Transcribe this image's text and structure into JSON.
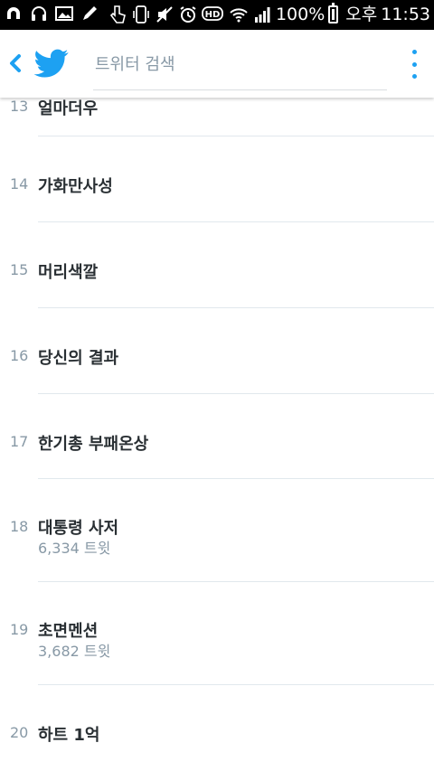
{
  "status_bar": {
    "battery_percent": "100%",
    "ampm": "오후",
    "time": "11:53",
    "hd_label": "HD"
  },
  "app_bar": {
    "search_placeholder": "트위터 검색"
  },
  "trends": [
    {
      "rank": "13",
      "title": "얼마더우",
      "tweets": ""
    },
    {
      "rank": "14",
      "title": "가화만사성",
      "tweets": ""
    },
    {
      "rank": "15",
      "title": "머리색깔",
      "tweets": ""
    },
    {
      "rank": "16",
      "title": "당신의 결과",
      "tweets": ""
    },
    {
      "rank": "17",
      "title": "한기총 부패온상",
      "tweets": ""
    },
    {
      "rank": "18",
      "title": "대통령 사저",
      "tweets": "6,334 트윗"
    },
    {
      "rank": "19",
      "title": "초면멘션",
      "tweets": "3,682 트윗"
    },
    {
      "rank": "20",
      "title": "하트 1억",
      "tweets": ""
    }
  ],
  "colors": {
    "accent": "#1da1f2",
    "text": "#292f33",
    "secondary": "#8899a6",
    "divider": "#e1e8ed"
  }
}
